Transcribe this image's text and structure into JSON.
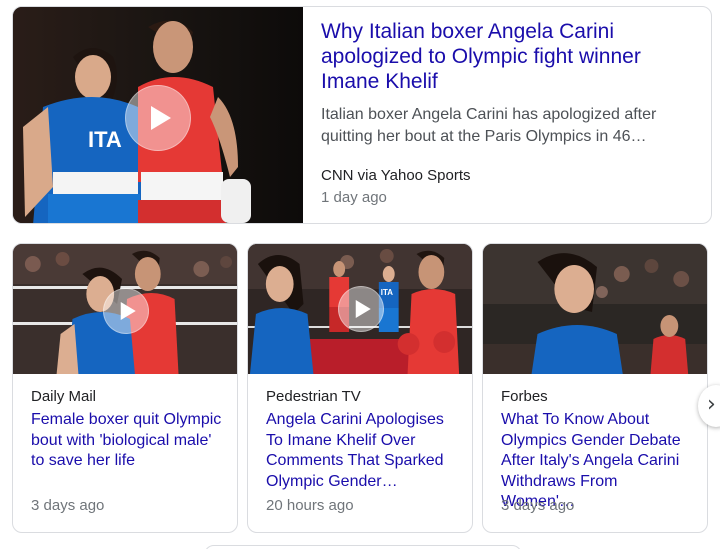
{
  "top_story": {
    "title": "Why Italian boxer Angela Carini apologized to Olympic fight winner Imane Khelif",
    "snippet": "Italian boxer Angela Carini has apologized after quitting her bout at the Paris Olympics in 46…",
    "source": "CNN via Yahoo Sports",
    "time": "1 day ago",
    "jersey_text": "ITA"
  },
  "stories": [
    {
      "source": "Daily Mail",
      "title": "Female boxer quit Olympic bout with 'biological male' to save her life",
      "time": "3 days ago",
      "has_video": true
    },
    {
      "source": "Pedestrian TV",
      "title": "Angela Carini Apologises To Imane Khelif Over Comments That Sparked Olympic Gender…",
      "time": "20 hours ago",
      "has_video": true,
      "jersey_text": "ITA"
    },
    {
      "source": "Forbes",
      "title": "What To Know About Olympics Gender Debate After Italy's Angela Carini Withdraws From Women'…",
      "time": "3 days ago",
      "has_video": false
    }
  ],
  "icons": {
    "play": "play-icon",
    "next": "chevron-right-icon"
  },
  "colors": {
    "link": "#1a0dab",
    "snippet": "#4d5156",
    "meta": "#70757a",
    "border": "#dadce0"
  },
  "next_glyph": "›"
}
